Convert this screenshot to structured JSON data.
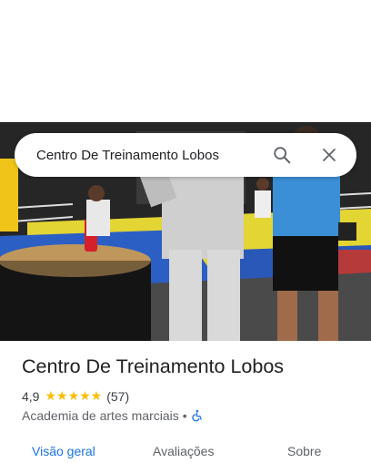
{
  "search": {
    "query": "Centro De Treinamento Lobos"
  },
  "place": {
    "name": "Centro De Treinamento Lobos",
    "rating": "4,9",
    "stars": "★★★★★",
    "review_count": "(57)",
    "category": "Academia de artes marciais",
    "separator": "•"
  },
  "tabs": [
    {
      "label": "Visão geral",
      "active": true
    },
    {
      "label": "Avaliações",
      "active": false
    },
    {
      "label": "Sobre",
      "active": false
    }
  ],
  "colors": {
    "accent": "#1a73e8",
    "star": "#fbbc04",
    "mat_yellow": "#e3d534",
    "mat_blue": "#2c5fc4"
  },
  "icons": {
    "search": "search-icon",
    "close": "close-icon",
    "accessibility": "wheelchair-icon"
  }
}
